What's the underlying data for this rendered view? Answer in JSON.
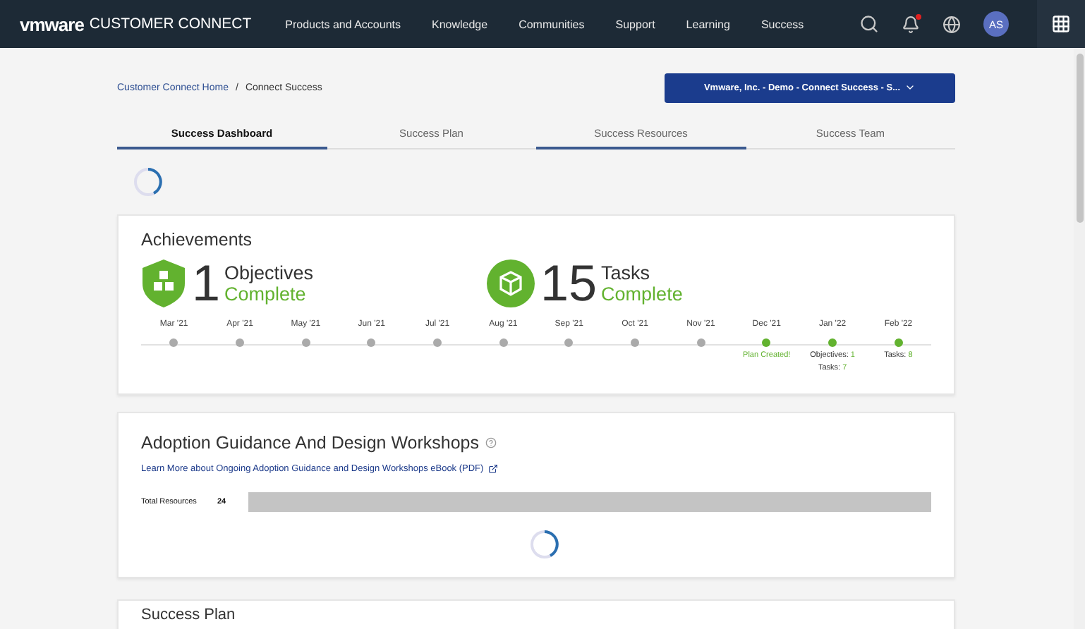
{
  "nav": {
    "brand": "vmware",
    "product": "CUSTOMER CONNECT",
    "items": [
      "Products and Accounts",
      "Knowledge",
      "Communities",
      "Support",
      "Learning",
      "Success"
    ],
    "avatar": "AS",
    "has_notification": true
  },
  "breadcrumb": {
    "items": [
      "Customer Connect Home",
      "Connect Success"
    ],
    "separator": "/"
  },
  "account_select": {
    "value": "Vmware, Inc. - Demo - Connect Success - S..."
  },
  "tabs": [
    {
      "label": "Success Dashboard",
      "selected": true
    },
    {
      "label": "Success Plan",
      "selected": false
    },
    {
      "label": "Success Resources",
      "selected": false,
      "hovered": true
    },
    {
      "label": "Success Team",
      "selected": false
    }
  ],
  "achievements": {
    "title": "Achievements",
    "stats": [
      {
        "kind": "shield",
        "count": "1",
        "label": "Objectives",
        "status": "Complete"
      },
      {
        "kind": "circle",
        "count": "15",
        "label": "Tasks",
        "status": "Complete"
      }
    ],
    "timeline": [
      {
        "month": "Mar '21",
        "done": false
      },
      {
        "month": "Apr '21",
        "done": false
      },
      {
        "month": "May '21",
        "done": false
      },
      {
        "month": "Jun '21",
        "done": false
      },
      {
        "month": "Jul '21",
        "done": false
      },
      {
        "month": "Aug '21",
        "done": false
      },
      {
        "month": "Sep '21",
        "done": false
      },
      {
        "month": "Oct '21",
        "done": false
      },
      {
        "month": "Nov '21",
        "done": false
      },
      {
        "month": "Dec '21",
        "done": true,
        "events": [
          {
            "kind": "milestone",
            "label": "Plan Created!"
          }
        ]
      },
      {
        "month": "Jan '22",
        "done": true,
        "events": [
          {
            "kind": "count",
            "label": "Objectives:",
            "value": "1"
          },
          {
            "kind": "count",
            "label": "Tasks:",
            "value": "7"
          }
        ]
      },
      {
        "month": "Feb '22",
        "done": true,
        "events": [
          {
            "kind": "count",
            "label": "Tasks:",
            "value": "8"
          }
        ]
      }
    ]
  },
  "workshops": {
    "title": "Adoption Guidance And Design Workshops",
    "link": "Learn More about Ongoing Adoption Guidance and Design Workshops eBook (PDF)",
    "resource_label": "Total Resources",
    "resource_count": "24"
  },
  "next_section": {
    "title": "Success Plan"
  }
}
